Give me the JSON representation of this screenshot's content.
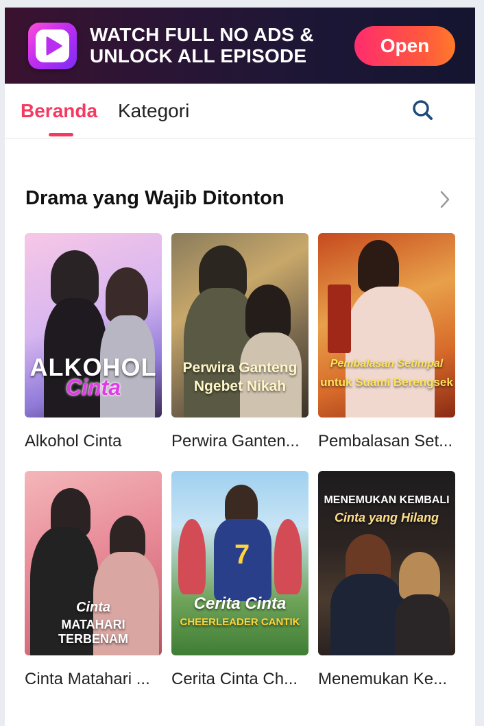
{
  "banner": {
    "line1": "WATCH FULL NO ADS &",
    "line2": "UNLOCK ALL EPISODE",
    "open_label": "Open",
    "logo_icon": "play-app-logo-icon",
    "accent": "#f43a61"
  },
  "nav": {
    "tabs": [
      {
        "label": "Beranda",
        "active": true
      },
      {
        "label": "Kategori",
        "active": false
      }
    ],
    "search_icon": "search-icon"
  },
  "section": {
    "title": "Drama yang Wajib Ditonton",
    "more_icon": "chevron-right-icon"
  },
  "dramas": [
    {
      "title": "Alkohol Cinta",
      "poster_line1": "ALKOHOL",
      "poster_line2": "Cinta"
    },
    {
      "title": "Perwira Ganten...",
      "poster_line1": "Perwira Ganteng",
      "poster_line2": "Ngebet Nikah"
    },
    {
      "title": "Pembalasan Set...",
      "poster_line1": "Pembalasan Setimpal",
      "poster_line2": "untuk Suami Berengsek"
    },
    {
      "title": "Cinta Matahari ...",
      "poster_line1": "Cinta",
      "poster_line2": "MATAHARI TERBENAM"
    },
    {
      "title": "Cerita Cinta Ch...",
      "poster_line1": "Cerita Cinta",
      "poster_line2": "CHEERLEADER CANTIK"
    },
    {
      "title": "Menemukan Ke...",
      "poster_line1": "MENEMUKAN KEMBALI",
      "poster_line2": "Cinta yang Hilang"
    }
  ]
}
